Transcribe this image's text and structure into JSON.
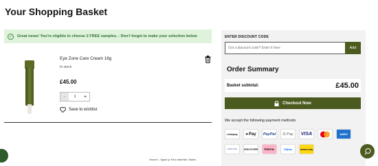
{
  "page_title": "Your Shopping Basket",
  "notice": {
    "text": "Great news! You're eligible to choose 2 FREE samples. - Don't forget to make your selection below"
  },
  "item": {
    "name": "Eye Zone Care Cream 18g",
    "stock": "In stock",
    "price": "£45.00",
    "quantity": "1",
    "minus": "−",
    "plus": "+",
    "wishlist": "Save to wishlist"
  },
  "discount": {
    "label": "ENTER DISCOUNT CODE",
    "placeholder": "Got a discount code? Enter it here",
    "button": "Add"
  },
  "summary": {
    "title": "Order Summary",
    "subtotal_label": "Basket subtotal:",
    "subtotal_value": "£45.00"
  },
  "checkout_label": "Checkout Now",
  "payment": {
    "heading": "We accept the following payment methods",
    "methods": [
      "clearpay",
      "Pay",
      "PayPal",
      "G Pay",
      "VISA",
      "Mastercard",
      "AMEX",
      "Diners Club",
      "DISCOVER",
      "Klarna.",
      "Alipay",
      "amazon pay"
    ]
  },
  "search_caption": "Search - Sgwd yr Eira waterfall, Wales",
  "colors": {
    "accent": "#4b5a1e",
    "notice_bg": "#dff3dc",
    "notice_text": "#2c6e2c"
  }
}
